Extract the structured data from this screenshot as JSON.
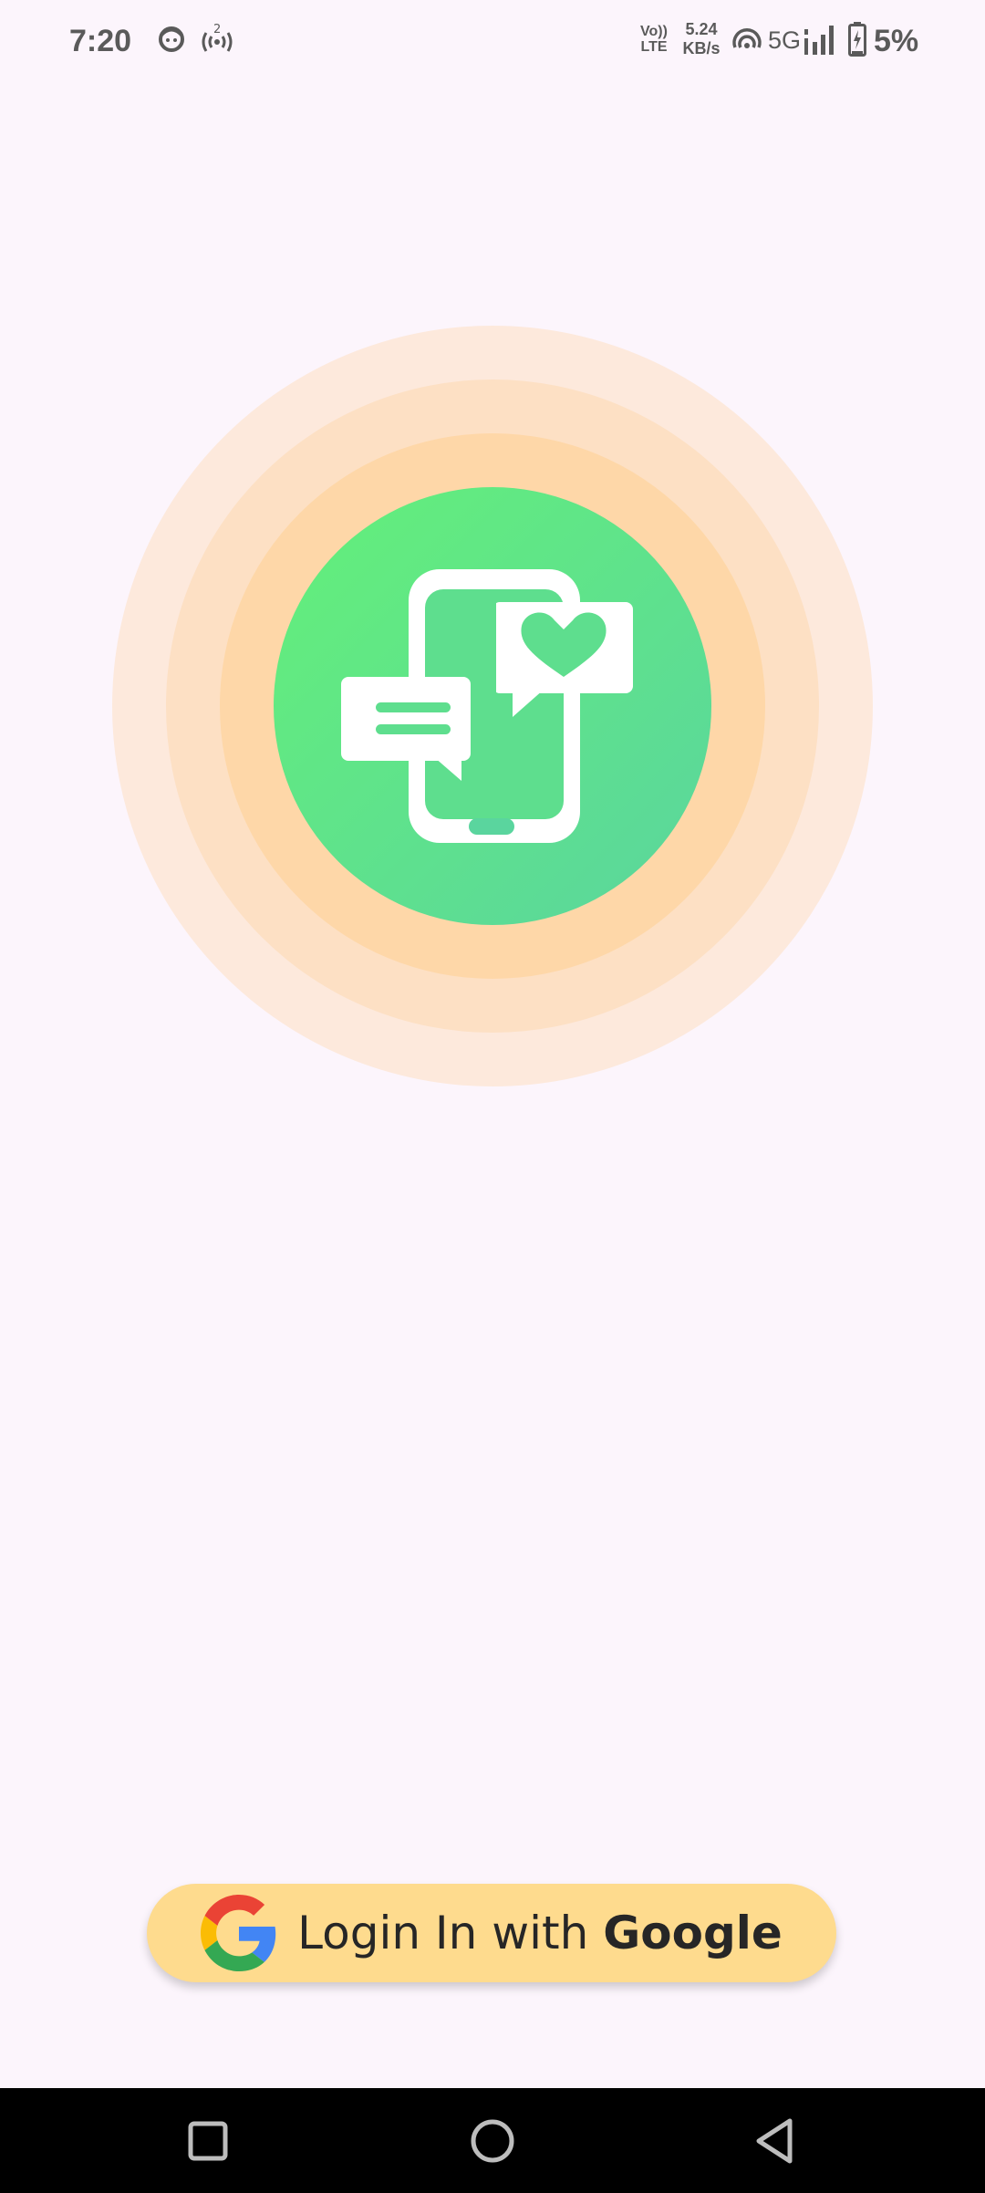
{
  "status_bar": {
    "time": "7:20",
    "volte_line1": "Vo))",
    "volte_line2": "LTE",
    "speed_value": "5.24",
    "speed_unit": "KB/s",
    "network_type": "5G",
    "battery_percent": "5%",
    "icons": [
      "face-notification-icon",
      "hotspot-icon",
      "volte-icon",
      "hotspot-signal-icon",
      "signal-strength-icon",
      "battery-charging-icon"
    ]
  },
  "hero": {
    "icon": "phone-chat-heart-icon",
    "colors": {
      "outer_ring": "#fde9dc",
      "middle_ring": "#fde0c4",
      "inner_ring": "#fed7a8",
      "circle_start": "#64f079",
      "circle_end": "#5ad59e"
    }
  },
  "login": {
    "label_prefix": "Login In with",
    "label_brand": "Google",
    "icon": "google-g-icon",
    "background": "#fedb8e"
  },
  "nav_bar": {
    "buttons": [
      "recent-apps-icon",
      "home-icon",
      "back-icon"
    ]
  }
}
